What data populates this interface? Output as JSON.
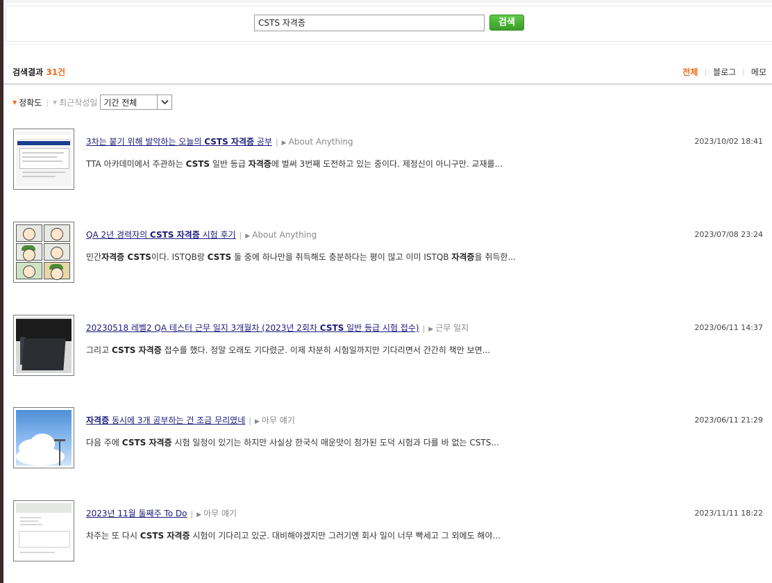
{
  "search": {
    "query": "CSTS 자격증",
    "button_label": "검색"
  },
  "results_header": {
    "label": "검색결과 ",
    "count": "31건"
  },
  "filter_tabs": [
    {
      "label": "전체",
      "active": true
    },
    {
      "label": "블로그",
      "active": false
    },
    {
      "label": "메모",
      "active": false
    }
  ],
  "sort": {
    "accuracy_label": "정확도",
    "recent_label": "최근작성일",
    "period_selected": "기간 전체"
  },
  "colors": {
    "accent": "#ef6b1c",
    "search_button": "#3a9d28",
    "link": "#1a1a7a"
  },
  "results": [
    {
      "title_parts": [
        "3차는 붙기 위해 발악하는 오늘의 ",
        "CSTS 자격증",
        " 공부"
      ],
      "category": "About Anything",
      "date": "2023/10/02 18:41",
      "snippet_parts": [
        "TTA 아카데미에서 주관하는 ",
        "CSTS",
        " 일반 등급 ",
        "자격증",
        "에 벌써 3번째 도전하고 있는 중이다. 제정신이 아니구만. 교재를..."
      ],
      "thumbnail": "screenshot-thumbnail"
    },
    {
      "title_parts": [
        "QA 2년 경력자의 ",
        "CSTS 자격증",
        " 시험 후기"
      ],
      "category": "About Anything",
      "date": "2023/07/08 23:24",
      "snippet_parts": [
        "민간",
        "자격증 CSTS",
        "이다. ISTQB랑 ",
        "CSTS",
        " 둘 중에 하나만을 취득해도 충분하다는 평이 많고 이미 ISTQB ",
        "자격증",
        "을 취득한..."
      ],
      "thumbnail": "comic-thumbnail"
    },
    {
      "title_parts": [
        "20230518 레벨2 QA 테스터 근무 일지 3개월차 (2023년 2회차 ",
        "CSTS",
        " 일반 등급 시험 접수)"
      ],
      "category": "근무 일지",
      "date": "2023/06/11 14:37",
      "snippet_parts": [
        "그리고 ",
        "CSTS 자격증",
        " 접수를 했다. 정말 오래도 기다렸군. 이제 차분히 시험일까지만 기다리면서 간간히 책만 보면..."
      ],
      "thumbnail": "monitor-photo-thumbnail"
    },
    {
      "title_parts": [
        "자격증",
        " 동시에 3개 공부하는 건 조금 무리였네"
      ],
      "category": "아무 얘기",
      "date": "2023/06/11 21:29",
      "snippet_parts": [
        "다음 주에 ",
        "CSTS 자격증",
        " 시험 일정이 있기는 하지만 사실상 한국식 매운맛이 첨가된 도덕 시험과 다를 바 없는 CSTS..."
      ],
      "thumbnail": "sky-photo-thumbnail"
    },
    {
      "title_parts": [
        "2023년 11월 둘째주 To Do"
      ],
      "category": "아무 얘기",
      "date": "2023/11/11 18:22",
      "snippet_parts": [
        "차주는 또 다시 ",
        "CSTS 자격증",
        " 시험이 기다리고 있군. 대비해야겠지만 그러기엔 회사 일이 너무 빡세고 그 외에도 해야..."
      ],
      "thumbnail": "document-thumbnail"
    }
  ]
}
